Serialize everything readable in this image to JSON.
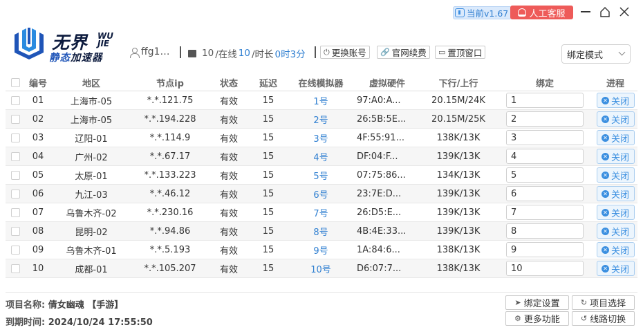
{
  "titlebar": {
    "version_label": "当前v1.67",
    "service_label": "人工客服",
    "colors": {
      "version_bg": "#dbeafc",
      "service_bg": "#ee5b59"
    }
  },
  "logo": {
    "title": "无界",
    "title_latin": "WU JIE",
    "sub_part1": "静态",
    "sub_part2": "加速器"
  },
  "header": {
    "username": "ffg1…",
    "stats": {
      "count": "10",
      "online_label": "/在线",
      "online": "10",
      "duration_label": "/时长",
      "duration": "0时3分"
    },
    "buttons": {
      "switch_account": "更换账号",
      "renew": "官网续费",
      "pin_window": "置顶窗口"
    },
    "bind_mode": "绑定模式"
  },
  "table": {
    "columns": [
      "编号",
      "地区",
      "节点ip",
      "状态",
      "延迟",
      "在线模拟器",
      "虚拟硬件",
      "下行/上行",
      "绑定",
      "进程"
    ],
    "rows": [
      {
        "id": "01",
        "region": "上海市-05",
        "ip": "*.*.121.75",
        "status": "有效",
        "delay": "15",
        "sim": "1号",
        "hw": "97:A0:A...",
        "speed": "20.15M/24K",
        "bind": "1",
        "action": "关闭"
      },
      {
        "id": "02",
        "region": "上海市-05",
        "ip": "*.*.194.228",
        "status": "有效",
        "delay": "15",
        "sim": "2号",
        "hw": "26:5B:5E...",
        "speed": "20.15M/25K",
        "bind": "2",
        "action": "关闭"
      },
      {
        "id": "03",
        "region": "辽阳-01",
        "ip": "*.*.114.9",
        "status": "有效",
        "delay": "15",
        "sim": "3号",
        "hw": "4F:55:91...",
        "speed": "138K/13K",
        "bind": "3",
        "action": "关闭"
      },
      {
        "id": "04",
        "region": "广州-02",
        "ip": "*.*.67.17",
        "status": "有效",
        "delay": "15",
        "sim": "4号",
        "hw": "DF:04:F...",
        "speed": "139K/13K",
        "bind": "4",
        "action": "关闭"
      },
      {
        "id": "05",
        "region": "太原-01",
        "ip": "*.*.133.223",
        "status": "有效",
        "delay": "15",
        "sim": "5号",
        "hw": "07:75:86...",
        "speed": "134K/13K",
        "bind": "5",
        "action": "关闭"
      },
      {
        "id": "06",
        "region": "九江-03",
        "ip": "*.*.46.12",
        "status": "有效",
        "delay": "15",
        "sim": "6号",
        "hw": "23:7E:D...",
        "speed": "139K/13K",
        "bind": "6",
        "action": "关闭"
      },
      {
        "id": "07",
        "region": "乌鲁木齐-02",
        "ip": "*.*.230.16",
        "status": "有效",
        "delay": "15",
        "sim": "7号",
        "hw": "26:D5:E...",
        "speed": "139K/13K",
        "bind": "7",
        "action": "关闭"
      },
      {
        "id": "08",
        "region": "昆明-02",
        "ip": "*.*.94.86",
        "status": "有效",
        "delay": "15",
        "sim": "8号",
        "hw": "4B:4E:33...",
        "speed": "139K/13K",
        "bind": "8",
        "action": "关闭"
      },
      {
        "id": "09",
        "region": "乌鲁木齐-01",
        "ip": "*.*.5.193",
        "status": "有效",
        "delay": "15",
        "sim": "9号",
        "hw": "1A:84:6...",
        "speed": "138K/13K",
        "bind": "9",
        "action": "关闭"
      },
      {
        "id": "10",
        "region": "成都-01",
        "ip": "*.*.105.207",
        "status": "有效",
        "delay": "15",
        "sim": "10号",
        "hw": "D6:07:7...",
        "speed": "138K/13K",
        "bind": "10",
        "action": "关闭"
      }
    ]
  },
  "footer": {
    "project_label": "项目名称:",
    "project_value": "倩女幽魂 【手游】",
    "expire_label": "到期时间:",
    "expire_value": "2024/10/24 17:55:50",
    "buttons": {
      "bind_settings": "绑定设置",
      "project_select": "项目选择",
      "more": "更多功能",
      "line_switch": "线路切换"
    }
  }
}
